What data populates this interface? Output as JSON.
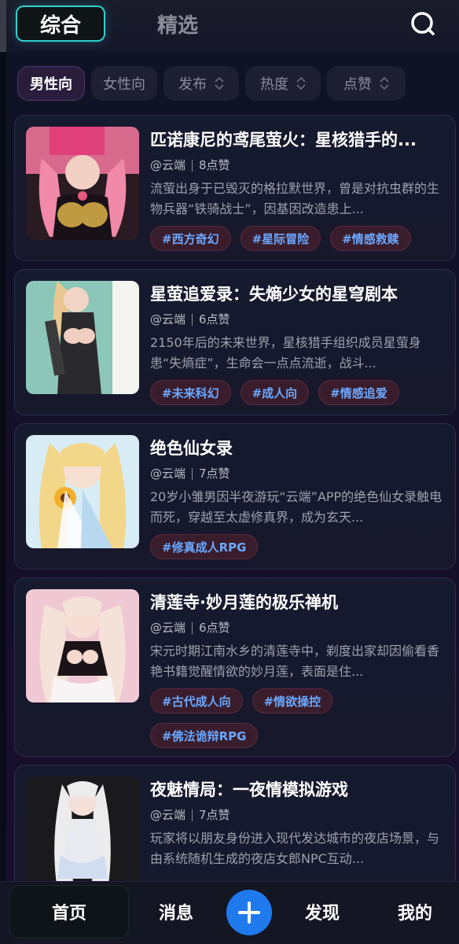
{
  "top_tabs": {
    "active": "综合",
    "inactive": "精选",
    "search_icon": "search-icon"
  },
  "filters": [
    {
      "label": "男性向",
      "active": true,
      "sortable": false
    },
    {
      "label": "女性向",
      "active": false,
      "sortable": false
    },
    {
      "label": "发布",
      "active": false,
      "sortable": true
    },
    {
      "label": "热度",
      "active": false,
      "sortable": true
    },
    {
      "label": "点赞",
      "active": false,
      "sortable": true
    }
  ],
  "cards": [
    {
      "title": "匹诺康尼的鸢尾萤火：星核猎手的...",
      "author": "@云端",
      "likes": "8点赞",
      "desc": "流萤出身于已毁灭的格拉默世界，曾是对抗虫群的生物兵器“铁骑战士”，因基因改造患上...",
      "tags": [
        "#西方奇幻",
        "#星际冒险",
        "#情感救赎"
      ]
    },
    {
      "title": "星萤追爱录：失熵少女的星穹剧本",
      "author": "@云端",
      "likes": "6点赞",
      "desc": "2150年后的未来世界，星核猎手组织成员星萤身患“失熵症”，生命会一点点流逝，战斗...",
      "tags": [
        "#未来科幻",
        "#成人向",
        "#情感追爱"
      ]
    },
    {
      "title": "绝色仙女录",
      "author": "@云端",
      "likes": "7点赞",
      "desc": "20岁小雏男因半夜游玩“云端”APP的绝色仙女录触电而死，穿越至太虚修真界，成为玄天...",
      "tags": [
        "#修真成人RPG"
      ]
    },
    {
      "title": "清莲寺·妙月莲的极乐禅机",
      "author": "@云端",
      "likes": "6点赞",
      "desc": "宋元时期江南水乡的清莲寺中，剃度出家却因偷看香艳书籍觉醒情欲的妙月莲，表面是住...",
      "tags": [
        "#古代成人向",
        "#情欲操控",
        "#佛法诡辩RPG"
      ]
    },
    {
      "title": "夜魅情局：一夜情模拟游戏",
      "author": "@云端",
      "likes": "7点赞",
      "desc": "玩家将以朋友身份进入现代发达城市的夜店场景，与由系统随机生成的夜店女郎NPC互动...",
      "tags": []
    }
  ],
  "bottom_nav": {
    "home": "首页",
    "messages": "消息",
    "discover": "发现",
    "mine": "我的",
    "plus_icon": "plus-icon"
  },
  "colors": {
    "accent_cyan": "#2fd0ce",
    "tag_text": "#6aa8ff",
    "tag_bg": "#3a1d2c",
    "plus_button": "#1f7aee"
  }
}
